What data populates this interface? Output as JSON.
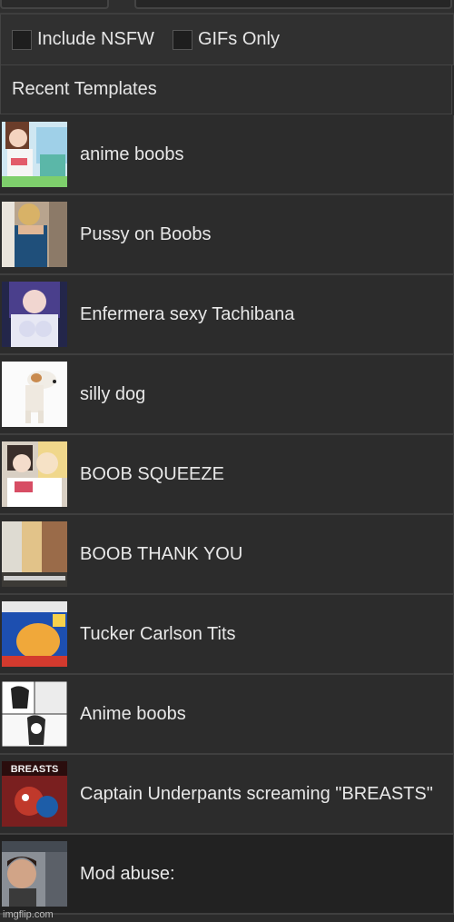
{
  "filters": {
    "nsfw_label": "Include NSFW",
    "gifs_label": "GIFs Only"
  },
  "recent": {
    "heading": "Recent Templates",
    "items": [
      {
        "label": "anime boobs",
        "thumb_text": ""
      },
      {
        "label": "Pussy on Boobs",
        "thumb_text": ""
      },
      {
        "label": "Enfermera sexy Tachibana",
        "thumb_text": ""
      },
      {
        "label": "silly dog",
        "thumb_text": ""
      },
      {
        "label": "BOOB SQUEEZE",
        "thumb_text": ""
      },
      {
        "label": "BOOB THANK YOU",
        "thumb_text": ""
      },
      {
        "label": "Tucker Carlson Tits",
        "thumb_text": ""
      },
      {
        "label": "Anime boobs",
        "thumb_text": ""
      },
      {
        "label": "Captain Underpants screaming \"BREASTS\"",
        "thumb_text": "BREASTS"
      },
      {
        "label": "Mod abuse:",
        "thumb_text": ""
      }
    ]
  },
  "watermark": "imgflip.com",
  "colors": {
    "background": "#2b2b2b",
    "text": "#e8e8e8",
    "active_row": "#222222"
  }
}
